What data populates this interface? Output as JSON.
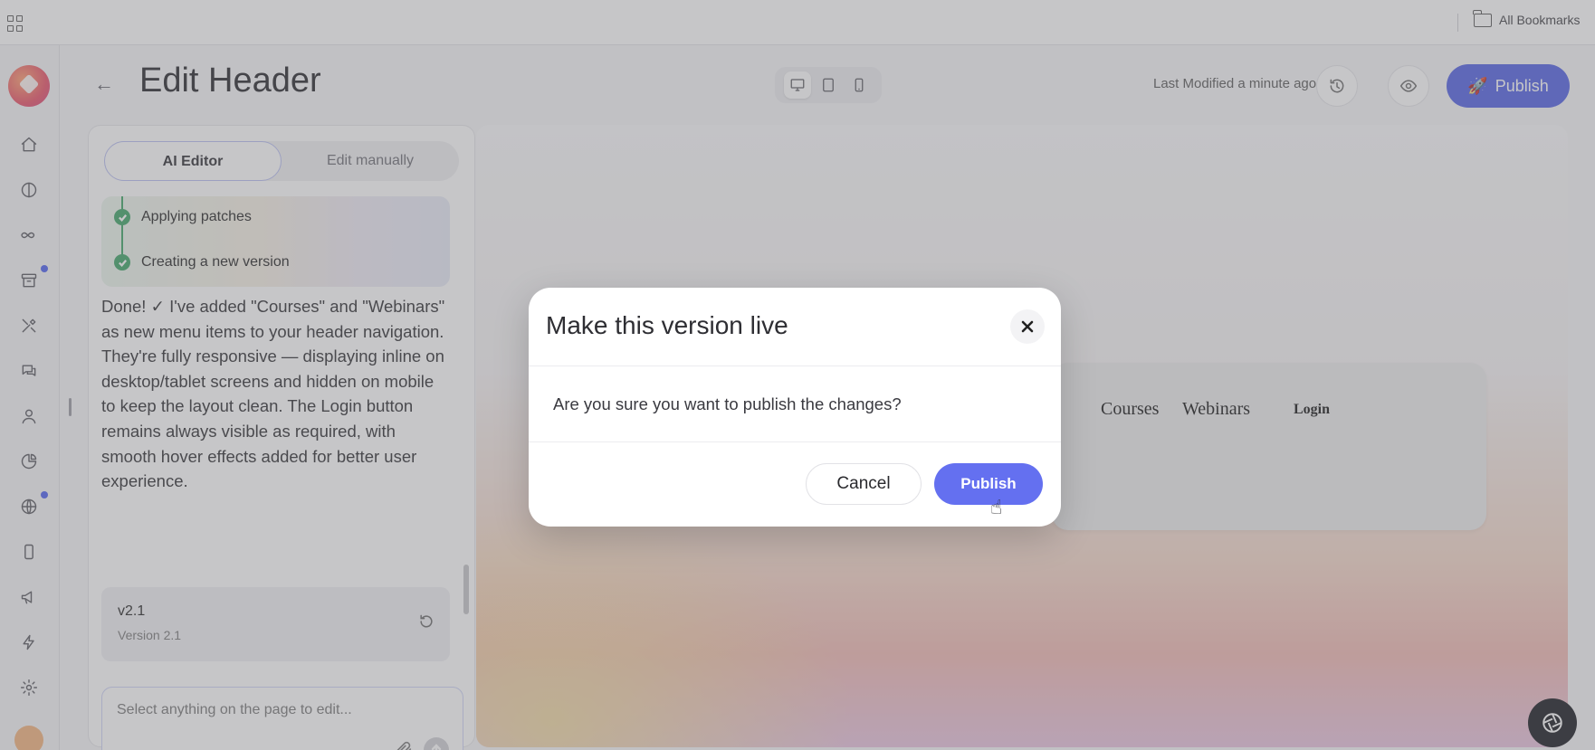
{
  "browser": {
    "bookmarks_label": "All Bookmarks"
  },
  "header": {
    "title": "Edit Header",
    "last_modified": "Last Modified a minute ago",
    "publish_label": "Publish",
    "device_modes": [
      "desktop",
      "tablet",
      "mobile"
    ],
    "active_device": "desktop"
  },
  "sidebar": {
    "icons": [
      "home-icon",
      "contrast-icon",
      "infinity-icon",
      "archive-icon",
      "tools-icon",
      "chat-icon",
      "user-icon",
      "pie-chart-icon",
      "globe-icon",
      "mobile-icon",
      "megaphone-icon",
      "lightning-icon",
      "settings-icon"
    ]
  },
  "editor": {
    "tabs": [
      {
        "label": "AI Editor",
        "active": true
      },
      {
        "label": "Edit manually",
        "active": false
      }
    ],
    "steps": [
      {
        "label": "Applying patches",
        "done": true
      },
      {
        "label": "Creating a new version",
        "done": true
      }
    ],
    "message": "Done! ✓ I've added \"Courses\" and \"Webinars\" as new menu items to your header navigation. They're fully responsive — displaying inline on desktop/tablet screens and hidden on mobile to keep the layout clean. The Login button remains always visible as required, with smooth hover effects added for better user experience.",
    "version": {
      "number": "v2.1",
      "label": "Version 2.1"
    },
    "prompt_placeholder": "Select anything on the page to edit..."
  },
  "preview": {
    "nav_items": [
      "Courses",
      "Webinars"
    ],
    "login_label": "Login"
  },
  "modal": {
    "title": "Make this version live",
    "body": "Are you sure you want to publish the changes?",
    "cancel_label": "Cancel",
    "confirm_label": "Publish"
  },
  "colors": {
    "accent": "#4e5ee4",
    "modal_confirm": "#6470f0",
    "success": "#3aa263",
    "notification_dot": "#4b5df0"
  }
}
